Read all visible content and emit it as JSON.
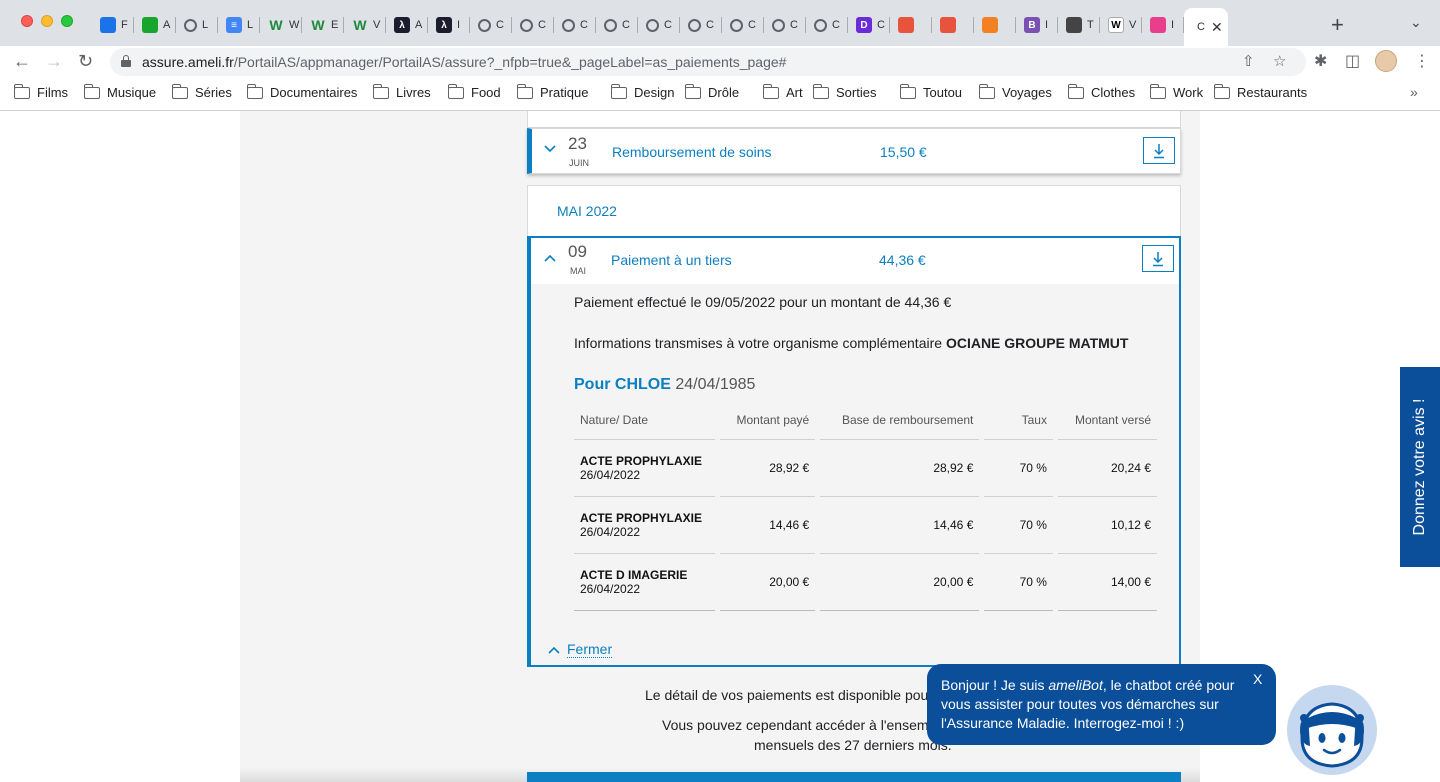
{
  "browser": {
    "tabs": [
      {
        "title": "F",
        "icon": "film-reel-icon",
        "color": "#1a73e8"
      },
      {
        "title": "A",
        "icon": "clock-green-icon",
        "color": "#18a52c"
      },
      {
        "title": "L",
        "icon": "globe-icon",
        "color": "#5f6368"
      },
      {
        "title": "L",
        "icon": "google-docs-icon",
        "color": "#4285f4"
      },
      {
        "title": "W",
        "icon": "w-green-icon",
        "color": "#1e8a3a"
      },
      {
        "title": "E",
        "icon": "w-green-icon",
        "color": "#1e8a3a"
      },
      {
        "title": "V",
        "icon": "w-green-icon",
        "color": "#1e8a3a"
      },
      {
        "title": "A",
        "icon": "lambda-dark-icon",
        "color": "#1c1c2e"
      },
      {
        "title": "I",
        "icon": "lambda-dark-icon",
        "color": "#1c1c2e"
      },
      {
        "title": "C",
        "icon": "globe-icon",
        "color": "#5f6368"
      },
      {
        "title": "C",
        "icon": "globe-icon",
        "color": "#5f6368"
      },
      {
        "title": "C",
        "icon": "globe-icon",
        "color": "#5f6368"
      },
      {
        "title": "C",
        "icon": "globe-icon",
        "color": "#5f6368"
      },
      {
        "title": "C",
        "icon": "globe-icon",
        "color": "#5f6368"
      },
      {
        "title": "C",
        "icon": "globe-icon",
        "color": "#5f6368"
      },
      {
        "title": "C",
        "icon": "globe-icon",
        "color": "#5f6368"
      },
      {
        "title": "C",
        "icon": "globe-icon",
        "color": "#5f6368"
      },
      {
        "title": "C",
        "icon": "globe-icon",
        "color": "#5f6368"
      },
      {
        "title": "C",
        "icon": "d-purple-icon",
        "color": "#6b2bd9"
      },
      {
        "title": "",
        "icon": "avatar-red-icon",
        "color": "#e8533c"
      },
      {
        "title": "",
        "icon": "avatar-red-icon",
        "color": "#e8533c"
      },
      {
        "title": "",
        "icon": "stackoverflow-icon",
        "color": "#f48024"
      },
      {
        "title": "I",
        "icon": "bootstrap-icon",
        "color": "#7952b3"
      },
      {
        "title": "T",
        "icon": "grid-icon",
        "color": "#444444"
      },
      {
        "title": "V",
        "icon": "wikipedia-icon",
        "color": "#ffffff"
      },
      {
        "title": "I",
        "icon": "flower-icon",
        "color": "#e83e8c"
      }
    ],
    "active_tab_title": "C",
    "url_host": "assure.ameli.fr",
    "url_path": "/PortailAS/appmanager/PortailAS/assure?_nfpb=true&_pageLabel=as_paiements_page#",
    "bookmarks": [
      "Films",
      "Musique",
      "Séries",
      "Documentaires",
      "Livres",
      "Food",
      "Pratique",
      "Design",
      "Drôle",
      "Art",
      "Sorties",
      "Toutou",
      "Voyages",
      "Clothes",
      "Work",
      "Restaurants"
    ],
    "bookmarks_more": "»"
  },
  "payments": {
    "row1": {
      "day": "23",
      "month": "JUIN",
      "title": "Remboursement de soins",
      "amount": "15,50 €"
    },
    "month_header": "MAI 2022",
    "row2": {
      "day": "09",
      "month": "MAI",
      "title": "Paiement à un tiers",
      "amount": "44,36 €",
      "effect_text": "Paiement effectué le 09/05/2022 pour un montant de 44,36 €",
      "infos_prefix": "Informations transmises à votre organisme complémentaire ",
      "infos_org": "OCIANE GROUPE MATMUT",
      "pour_label": "Pour CHLOE",
      "pour_date": "24/04/1985",
      "columns": [
        "Nature/ Date",
        "Montant payé",
        "Base de remboursement",
        "Taux",
        "Montant versé"
      ],
      "rows": [
        {
          "nature": "ACTE PROPHYLAXIE",
          "date": "26/04/2022",
          "paye": "28,92 €",
          "base": "28,92 €",
          "taux": "70 %",
          "verse": "20,24 €"
        },
        {
          "nature": "ACTE PROPHYLAXIE",
          "date": "26/04/2022",
          "paye": "14,46 €",
          "base": "14,46 €",
          "taux": "70 %",
          "verse": "10,12 €"
        },
        {
          "nature": "ACTE D IMAGERIE",
          "date": "26/04/2022",
          "paye": "20,00 €",
          "base": "20,00 €",
          "taux": "70 %",
          "verse": "14,00 €"
        }
      ],
      "close_label": "Fermer"
    }
  },
  "info_text": {
    "line1": "Le détail de vos paiements est disponible pou",
    "line2": "Vous pouvez cependant accéder à l'ensem",
    "line3": "mensuels des 27 derniers mois."
  },
  "feedback_label": "Donnez votre avis !",
  "chatbot": {
    "prefix": "Bonjour ! Je suis ",
    "name": "ameliBot",
    "suffix": ", le chatbot créé pour vous assister pour toutes vos démarches sur l'Assurance Maladie. Interrogez-moi ! :)",
    "close": "X"
  },
  "colors": {
    "accent": "#0c7fc2",
    "dark_blue": "#0b4e9a"
  }
}
